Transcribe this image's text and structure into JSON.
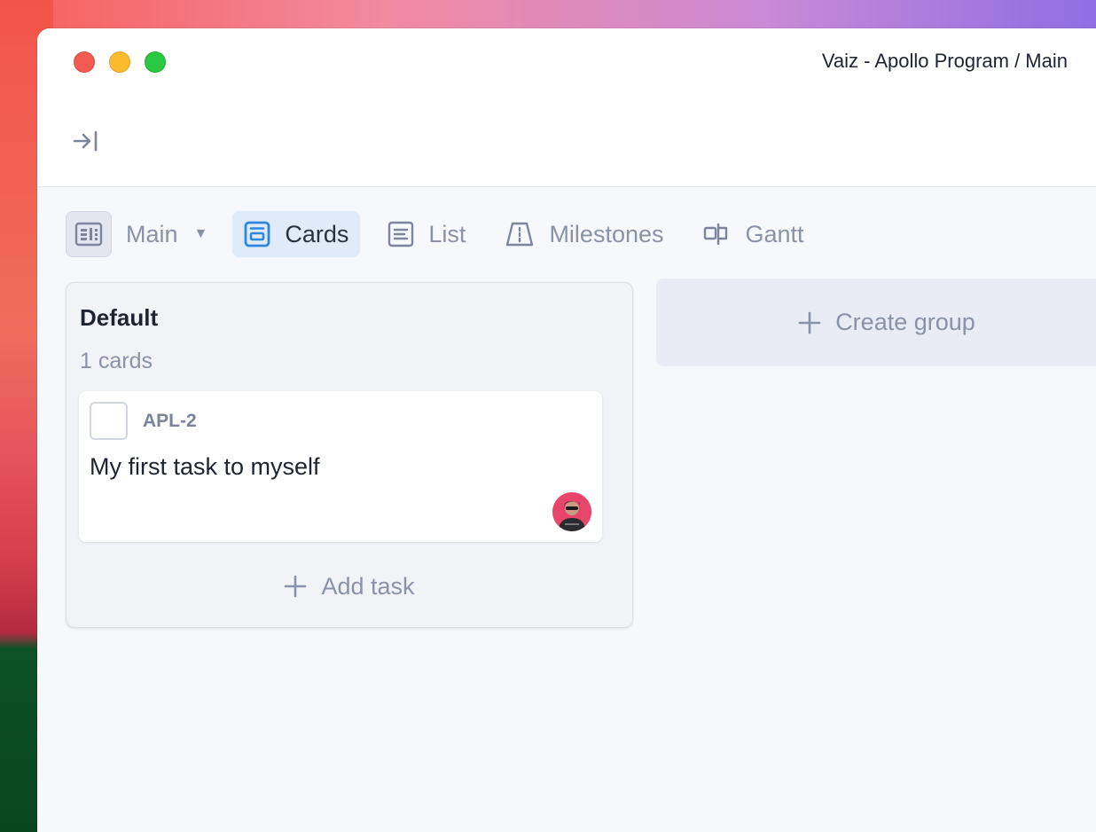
{
  "window": {
    "title": "Vaiz - Apollo Program / Main"
  },
  "icons": {
    "expand": "expand-sidebar-icon",
    "board": "board-icon",
    "cards": "cards-icon",
    "list": "list-icon",
    "milestones": "milestones-icon",
    "gantt": "gantt-icon",
    "plus": "plus-icon",
    "caret": "caret-down-icon"
  },
  "viewbar": {
    "board_name": "Main",
    "tabs": [
      {
        "label": "Cards",
        "active": true
      },
      {
        "label": "List",
        "active": false
      },
      {
        "label": "Milestones",
        "active": false
      },
      {
        "label": "Gantt",
        "active": false
      }
    ]
  },
  "group": {
    "title": "Default",
    "count": "1 cards",
    "add_task_label": "Add task",
    "cards": [
      {
        "key": "APL-2",
        "title": "My first task to myself"
      }
    ]
  },
  "create_group_label": "Create group",
  "colors": {
    "accent": "#2f86dd",
    "active_tab_bg": "#e0ebfa",
    "muted_text": "#8a92a6"
  }
}
